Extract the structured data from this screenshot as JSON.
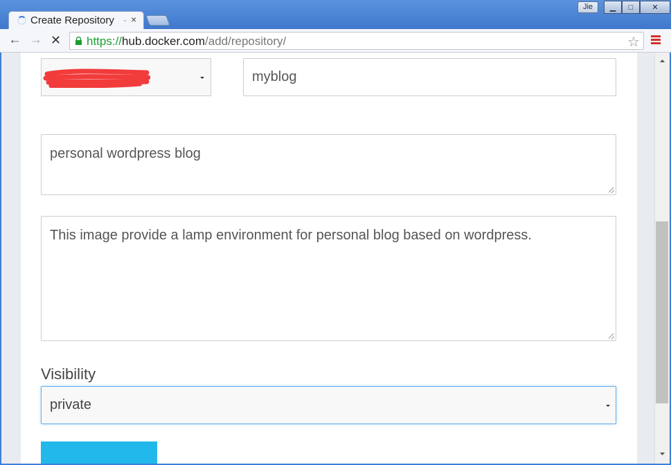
{
  "window": {
    "user_badge": "Jie",
    "minimize": "▁",
    "maximize": "□",
    "close": "✕"
  },
  "tab": {
    "title": "Create Repository",
    "fade": "-",
    "close_glyph": "×"
  },
  "toolbar": {
    "back_glyph": "←",
    "forward_glyph": "→",
    "stop_glyph": "✕",
    "url_scheme": "https://",
    "url_host": "hub.docker.com",
    "url_path": "/add/repository/",
    "star_glyph": "☆"
  },
  "form": {
    "namespace_value": "",
    "name_value": "myblog",
    "short_description": "personal wordpress blog",
    "full_description": "This image provide a lamp environment for personal blog based on wordpress.",
    "visibility_label": "Visibility",
    "visibility_value": "private"
  },
  "colors": {
    "redaction": "#f23b3b",
    "create_button": "#22b8eb",
    "focus_border": "#66afe9",
    "url_scheme": "#1b9c33",
    "menu_icon": "#d3312a"
  }
}
